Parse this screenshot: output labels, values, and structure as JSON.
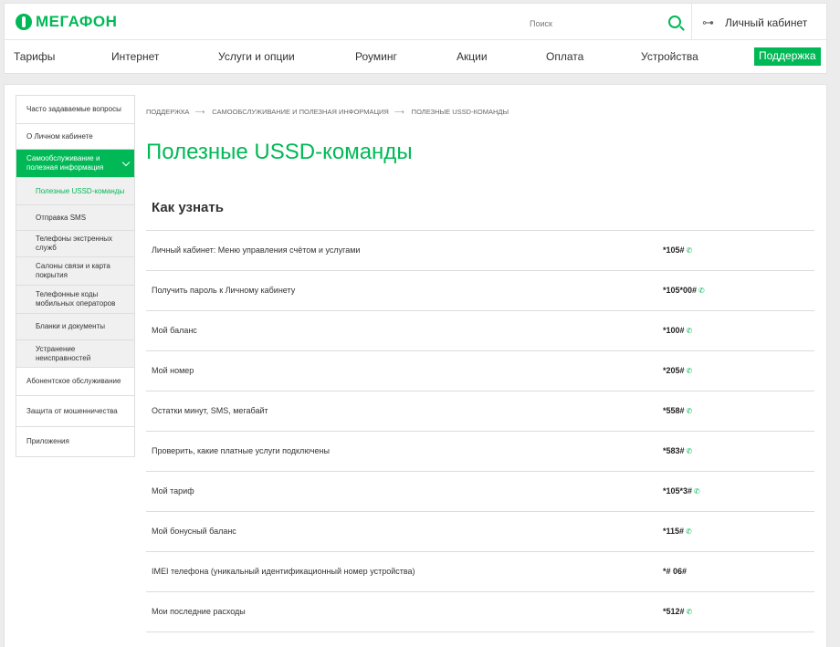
{
  "header": {
    "logo_text": "МегаФон",
    "search_placeholder": "Поиск",
    "account_label": "Личный кабинет",
    "nav": [
      "Тарифы",
      "Интернет",
      "Услуги и опции",
      "Роуминг",
      "Акции",
      "Оплата",
      "Устройства"
    ],
    "support_label": "Поддержка"
  },
  "sidebar": {
    "items": [
      {
        "label": "Часто задаваемые вопросы"
      },
      {
        "label": "О Личном кабинете"
      },
      {
        "label": "Самообслуживание и полезная информация"
      },
      {
        "label": "Полезные USSD-команды"
      },
      {
        "label": "Отправка SMS"
      },
      {
        "label": "Телефоны экстренных служб"
      },
      {
        "label": "Салоны связи и карта покрытия"
      },
      {
        "label": "Телефонные коды мобильных операторов"
      },
      {
        "label": "Бланки и документы"
      },
      {
        "label": "Устранение неисправностей"
      },
      {
        "label": "Абонентское обслуживание"
      },
      {
        "label": "Защита от мошенничества"
      },
      {
        "label": "Приложения"
      }
    ]
  },
  "breadcrumb": [
    "ПОДДЕРЖКА",
    "САМООБСЛУЖИВАНИЕ И ПОЛЕЗНАЯ ИНФОРМАЦИЯ",
    "ПОЛЕЗНЫЕ USSD-КОМАНДЫ"
  ],
  "page_title": "Полезные USSD-команды",
  "section_title": "Как узнать",
  "rows": [
    {
      "label": "Личный кабинет: Меню управления счётом и услугами",
      "code": "*105#",
      "icon": "phone-icon"
    },
    {
      "label": "Получить пароль к Личному кабинету",
      "code": "*105*00#",
      "icon": "phone-icon"
    },
    {
      "label": "Мой баланс",
      "code": "*100#",
      "icon": "phone-icon"
    },
    {
      "label": "Мой номер",
      "code": "*205#",
      "icon": "phone-icon"
    },
    {
      "label": "Остатки минут, SMS, мегабайт",
      "code": "*558#",
      "icon": "phone-icon"
    },
    {
      "label": "Проверить, какие платные услуги подключены",
      "code": "*583#",
      "icon": "phone-icon"
    },
    {
      "label": "Мой тариф",
      "code": "*105*3#",
      "icon": "phone-icon"
    },
    {
      "label": "Мой бонусный баланс",
      "code": "*115#",
      "icon": "phone-icon"
    },
    {
      "label": "IMEI телефона (уникальный идентификационный номер устройства)",
      "code": "*# 06#",
      "icon": ""
    },
    {
      "label": "Мои последние расходы",
      "code": "*512#",
      "icon": "phone-icon"
    }
  ],
  "colors": {
    "brand": "#00b956",
    "text": "#333333",
    "border": "#dcdcdc"
  }
}
